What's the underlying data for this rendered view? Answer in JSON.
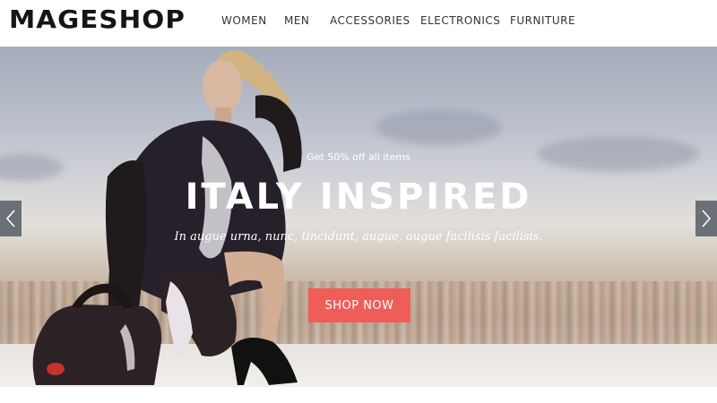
{
  "header": {
    "logo": "MAGESHOP",
    "nav": [
      {
        "label": "WOMEN"
      },
      {
        "label": "MEN"
      },
      {
        "label": "ACCESSORIES"
      },
      {
        "label": "ELECTRONICS"
      },
      {
        "label": "FURNITURE"
      }
    ]
  },
  "hero": {
    "subtitle": "Get 50% off all items",
    "headline": "ITALY INSPIRED",
    "tagline": "In augue urna, nunc, tincidunt, augue, augue facilisis facilisis.",
    "cta": "SHOP NOW",
    "cta_color": "#ee5d57",
    "prev_icon": "chevron-left-icon",
    "next_icon": "chevron-right-icon"
  }
}
